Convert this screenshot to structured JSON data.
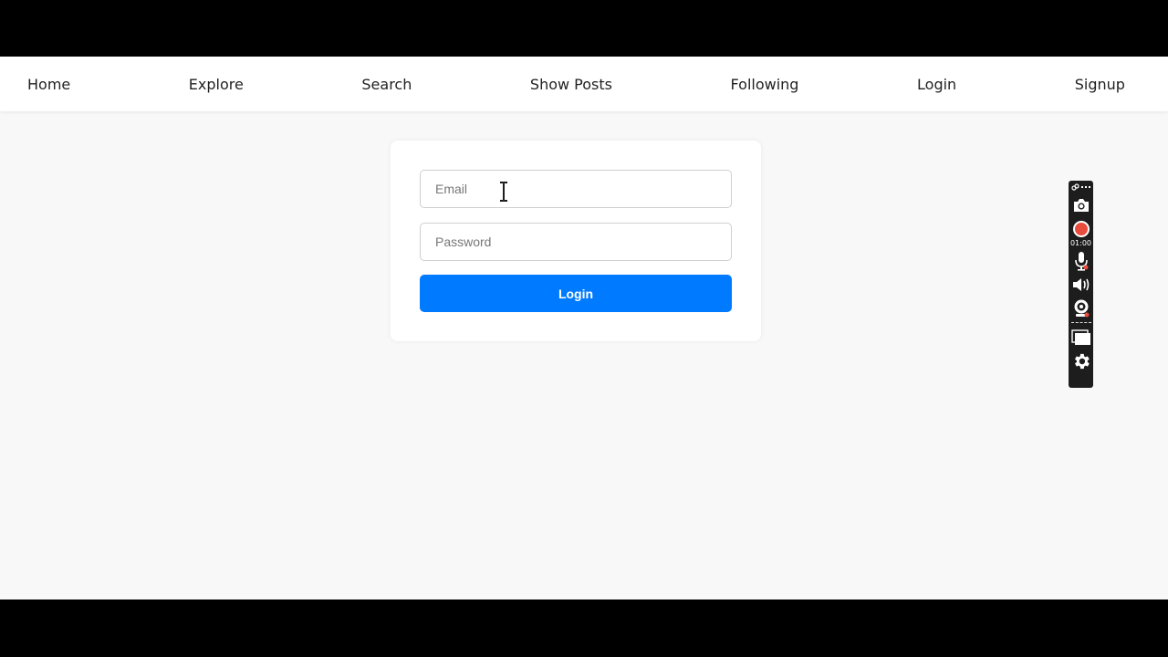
{
  "nav": {
    "home": "Home",
    "explore": "Explore",
    "search": "Search",
    "show_posts": "Show Posts",
    "following": "Following",
    "login": "Login",
    "signup": "Signup"
  },
  "login_form": {
    "email_placeholder": "Email",
    "email_value": "",
    "password_placeholder": "Password",
    "password_value": "",
    "submit_label": "Login"
  },
  "recorder": {
    "timer": "01:00",
    "icons": [
      "link-icon",
      "more-icon",
      "camera-icon",
      "record-icon",
      "microphone-icon",
      "speaker-icon",
      "webcam-icon",
      "window-icon",
      "gear-icon"
    ]
  },
  "colors": {
    "accent": "#007bff",
    "page_background": "#f8f8f8",
    "record": "#e74c3c"
  }
}
